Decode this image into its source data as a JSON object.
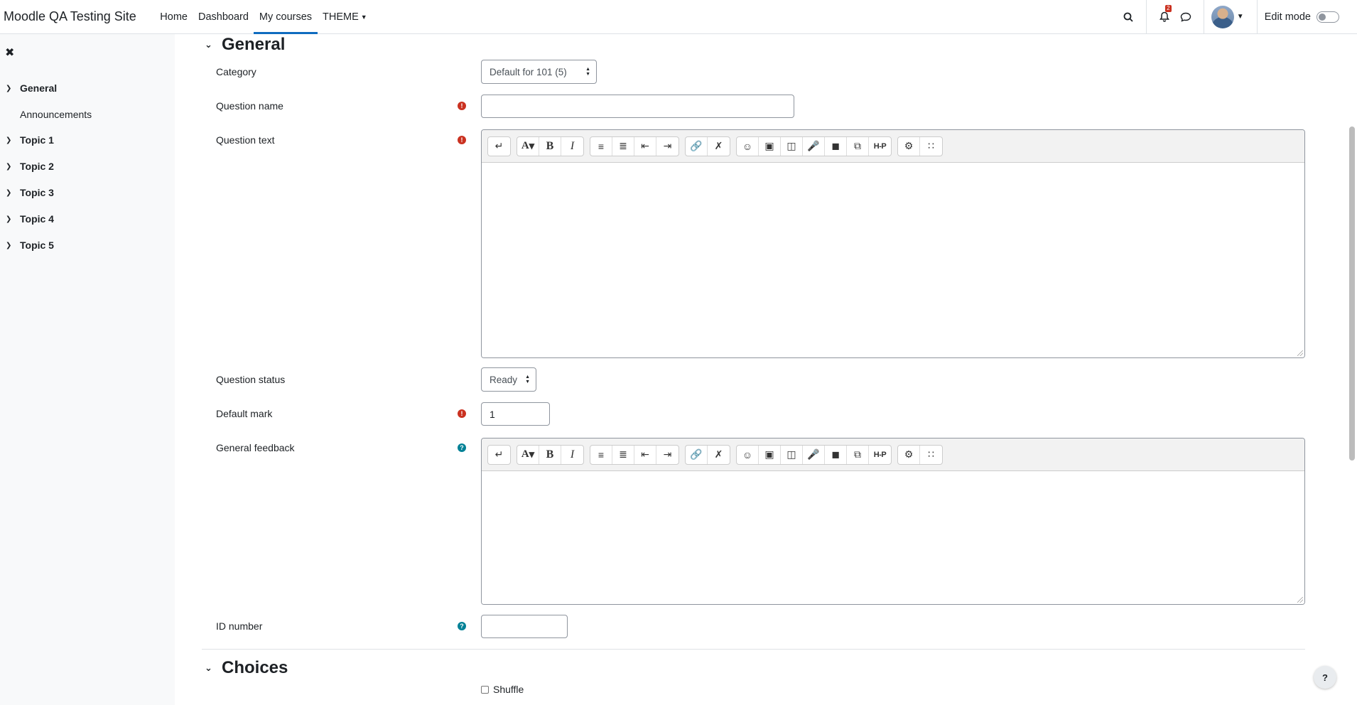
{
  "navbar": {
    "brand": "Moodle QA Testing Site",
    "links": [
      "Home",
      "Dashboard",
      "My courses",
      "THEME"
    ],
    "notification_count": "2",
    "edit_mode_label": "Edit mode"
  },
  "drawer": {
    "items": [
      {
        "label": "General"
      },
      {
        "label": "Announcements"
      },
      {
        "label": "Topic 1"
      },
      {
        "label": "Topic 2"
      },
      {
        "label": "Topic 3"
      },
      {
        "label": "Topic 4"
      },
      {
        "label": "Topic 5"
      }
    ]
  },
  "form": {
    "general_section": "General",
    "category_label": "Category",
    "category_value": "Default for 101 (5)",
    "question_name_label": "Question name",
    "question_name_value": "",
    "question_text_label": "Question text",
    "question_status_label": "Question status",
    "question_status_value": "Ready",
    "default_mark_label": "Default mark",
    "default_mark_value": "1",
    "general_feedback_label": "General feedback",
    "id_number_label": "ID number",
    "id_number_value": "",
    "choices_section": "Choices",
    "shuffle_label": "Shuffle"
  },
  "toolbar": {
    "font_glyph": "A",
    "bold_glyph": "B",
    "italic_glyph": "I",
    "h5p_glyph": "H-P"
  },
  "help_button": "?",
  "colors": {
    "accent": "#0f6cbf",
    "required": "#ca3120",
    "help": "#008196",
    "drawer_bg": "#f8f9fa"
  }
}
